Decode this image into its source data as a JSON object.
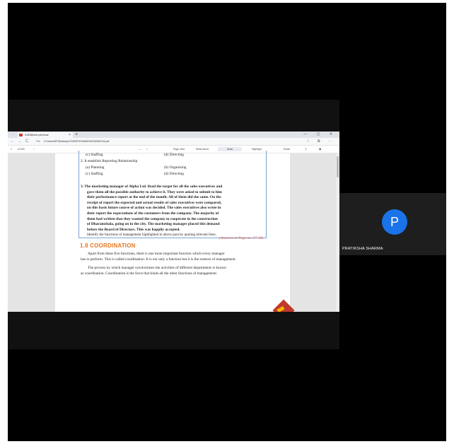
{
  "browser": {
    "tab_title": "9c5056rsetr.pdfvirtual",
    "tab_close": "×",
    "new_tab": "+",
    "window_controls": "— ▢ ✕",
    "nav": {
      "back": "←",
      "forward": "→",
      "reload": "C"
    },
    "address": {
      "file_label": "File",
      "url": "C:/Users/HP/Desktop/12%20POONAM%20SANDHYA.pdf"
    },
    "pdf_toolbar": {
      "page": "of 520",
      "zoom_out": "—",
      "zoom_in": "+",
      "page_view": "Page view",
      "read_aloud": "Read aloud",
      "draw": "Draw",
      "highlight": "Highlight",
      "erase": "Erase"
    }
  },
  "document": {
    "options_block_1": {
      "c": "(c) Staffing",
      "d": "(d) Directing"
    },
    "question_2": "2.  It establish Reporting Relationship",
    "options_block_2": {
      "a": "(a) Planning",
      "b": "(b) Organising",
      "c": "(c) Staffing",
      "d": "(d) Directing"
    },
    "question_3_lines": [
      "3.  The marketing manager of Alpha Ltd. fixed the target for all the sales executives and",
      "gave them all the possible authority to achieve it. They were asked to submit to him",
      "their performance report at the end of the month. All of them did the same. On the",
      "receipt of report the expected and actual results of sales executives were compared,",
      "on this basis future course of action was decided. The sales executives also wrote in",
      "their report the expectations of the customers from the company. The majority of",
      "them had written that they wanted the company to cooperate in the construction",
      "of Dharamshala, going on in the city. The marketing manager placed this demand",
      "before the Board of Directors. This was happily accepted."
    ],
    "identify_line": "Identify the functions of management highlighted in above para by quoting relevant lines.",
    "answer_ref": "(Answers at Page no. 57-58)",
    "section_title": "1.8 COORDINATION",
    "section_para_1": [
      "Apart from these five functions, there is one more important function which every manager",
      "has to perform. This is called coordination. It is not only a function but it is the essence of management."
    ],
    "section_para_2": [
      "The process by which manager synchronises the activities of different departments is known",
      "as coordination. Coordination is the force that binds all the other functions of management."
    ]
  },
  "participant": {
    "avatar_letter": "P",
    "name": "PRATIKSHA SHARMA",
    "avatar_color": "#1a73e8"
  }
}
